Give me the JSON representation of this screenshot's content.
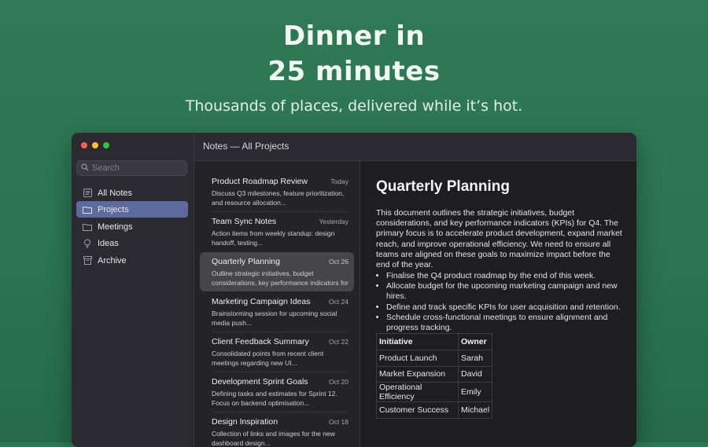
{
  "hero": {
    "line1": "Dinner in",
    "line2": "25 minutes",
    "subtitle": "Thousands of places, delivered while it’s hot."
  },
  "window": {
    "title": "Notes — All Projects"
  },
  "sidebar": {
    "search_placeholder": "Search",
    "items": [
      {
        "label": "All Notes",
        "icon": "notes-list-icon",
        "active": false
      },
      {
        "label": "Projects",
        "icon": "folder-icon",
        "active": true
      },
      {
        "label": "Meetings",
        "icon": "folder-icon",
        "active": false
      },
      {
        "label": "Ideas",
        "icon": "lightbulb-icon",
        "active": false
      },
      {
        "label": "Archive",
        "icon": "archive-box-icon",
        "active": false
      }
    ]
  },
  "notes": [
    {
      "title": "Product Roadmap Review",
      "date": "Today",
      "preview": "Discuss Q3 milestones, feature prioritization, and resource allocation..."
    },
    {
      "title": "Team Sync Notes",
      "date": "Yesterday",
      "preview": "Action items from weekly standup: design handoff, testing..."
    },
    {
      "title": "Quarterly Planning",
      "date": "Oct 26",
      "preview": "Outline strategic initiatives, budget considerations, key performance indicators for"
    },
    {
      "title": "Marketing Campaign Ideas",
      "date": "Oct 24",
      "preview": "Brainstorming session for upcoming social media push..."
    },
    {
      "title": "Client Feedback Summary",
      "date": "Oct 22",
      "preview": "Consolidated points from recent client meetings regarding new UI..."
    },
    {
      "title": "Development Sprint Goals",
      "date": "Oct 20",
      "preview": "Defining tasks and estimates for Sprint 12. Focus on backend optimisation..."
    },
    {
      "title": "Design Inspiration",
      "date": "Oct 18",
      "preview": "Collection of links and images for the new dashboard design..."
    }
  ],
  "detail": {
    "title": "Quarterly Planning",
    "paragraph": "This document outlines the strategic initiatives, budget considerations, and key performance indicators (KPIs) for Q4. The primary focus is to accelerate product development, expand market reach, and improve operational efficiency. We need to ensure all teams are aligned on these goals to maximize impact before the end of the year.",
    "bullets": [
      "Finalise the Q4 product roadmap by the end of this week.",
      "Allocate budget for the upcoming marketing campaign and new hires.",
      "Define and track specific KPIs for user acquisition and retention.",
      "Schedule cross-functional meetings to ensure alignment and progress tracking."
    ],
    "table": {
      "headers": [
        "Initiative",
        "Owner"
      ],
      "rows": [
        [
          "Product Launch",
          "Sarah"
        ],
        [
          "Market Expansion",
          "David"
        ],
        [
          "Operational Efficiency",
          "Emily"
        ],
        [
          "Customer Success",
          "Michael"
        ]
      ]
    }
  }
}
